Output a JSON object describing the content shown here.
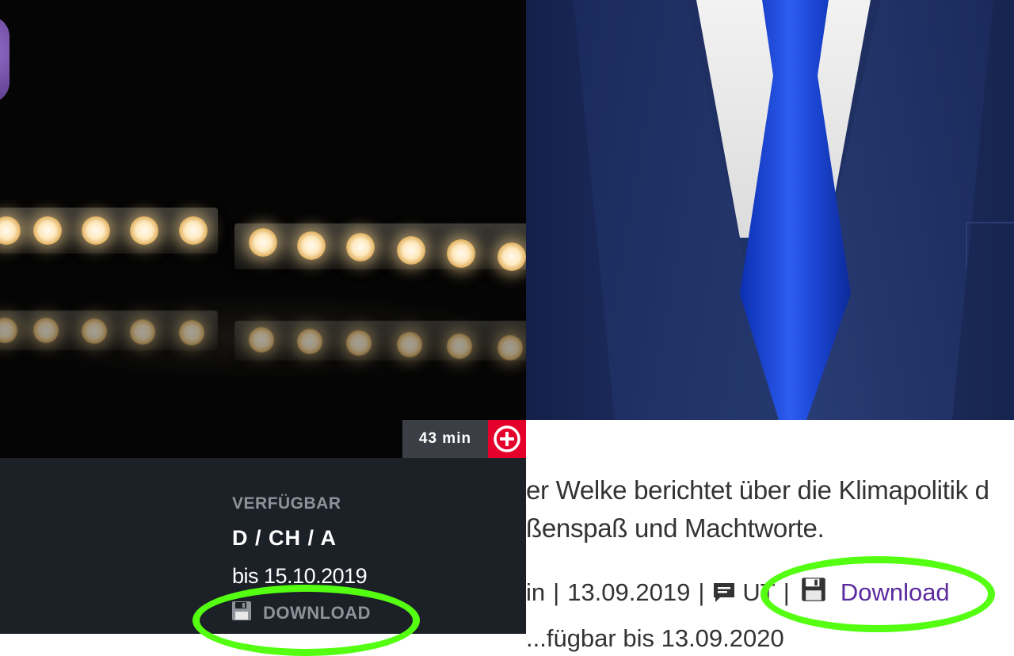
{
  "video_card": {
    "duration": "43 min",
    "add_icon": "plus-circle-icon",
    "availability": {
      "label": "VERFÜGBAR",
      "regions": "D / CH / A",
      "until": "bis 15.10.2019"
    },
    "download": {
      "label": "DOWNLOAD",
      "icon": "floppy-disk-icon"
    }
  },
  "episode": {
    "description_line1": "er Welke berichtet über die Klimapolitik d",
    "description_line2": "ßenspaß und Machtworte.",
    "meta": {
      "duration_fragment": "in",
      "separator": "|",
      "date": "13.09.2019",
      "comment_icon": "comment-icon",
      "subtitle_fragment": "UT",
      "download_label": "Download",
      "download_icon": "floppy-disk-icon"
    },
    "bottom_fragment": "...fügbar bis 13.09.2020"
  },
  "colors": {
    "accent_red": "#e4002b",
    "panel_dark": "#1c2128",
    "link_purple": "#5b2a9e",
    "annotation_green": "#55ff11"
  }
}
